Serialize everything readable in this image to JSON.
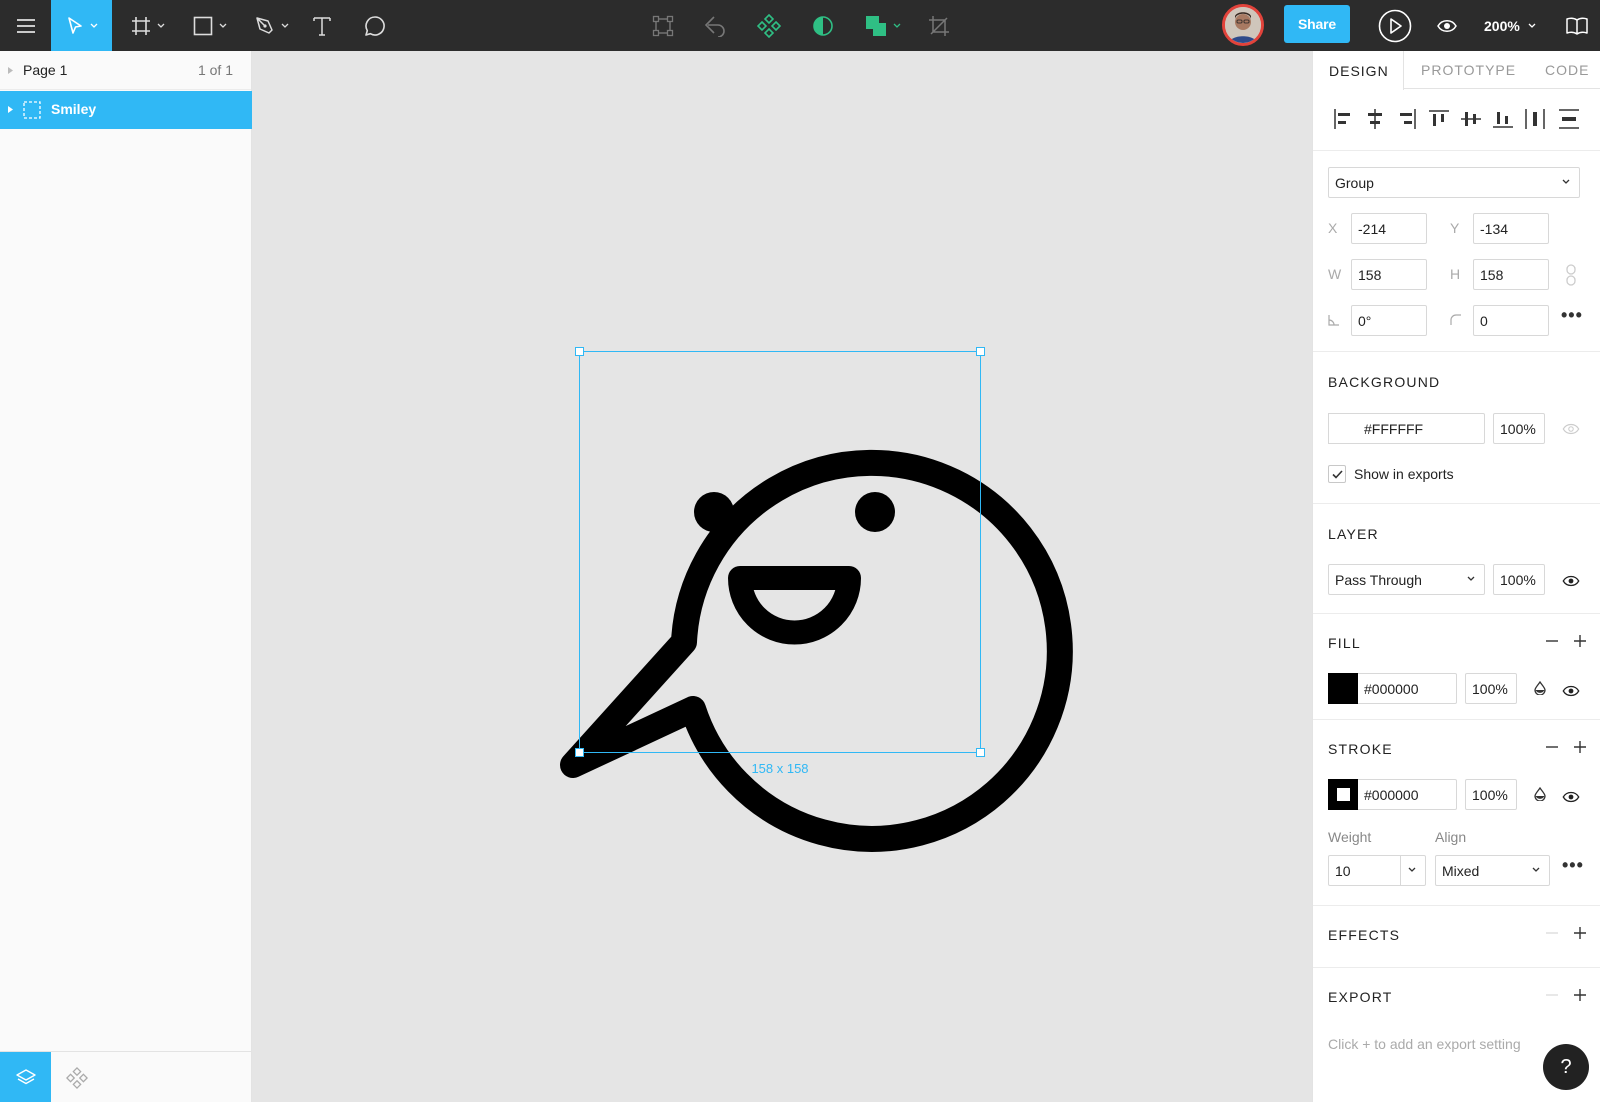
{
  "toolbar": {
    "share_label": "Share",
    "zoom_label": "200%",
    "tools": [
      "menu-icon",
      "move-icon",
      "frame-icon",
      "rectangle-icon",
      "pen-icon",
      "text-icon",
      "comment-icon"
    ],
    "center_tools": [
      "component-bounds-icon",
      "boolean-icon",
      "create-component-icon",
      "mask-icon",
      "union-icon",
      "crop-icon"
    ],
    "accent": "#30b8f5"
  },
  "left_panel": {
    "page_name": "Page 1",
    "page_count": "1 of 1",
    "layers": [
      {
        "name": "Smiley",
        "selected": true
      }
    ]
  },
  "canvas": {
    "selection_size": "158 x 158",
    "background": "#e5e5e5"
  },
  "right_panel": {
    "tabs": [
      "DESIGN",
      "PROTOTYPE",
      "CODE"
    ],
    "active_tab": "DESIGN",
    "group_select": "Group",
    "x_label": "X",
    "x_value": "-214",
    "y_label": "Y",
    "y_value": "-134",
    "w_label": "W",
    "w_value": "158",
    "h_label": "H",
    "h_value": "158",
    "rotation_value": "0°",
    "radius_value": "0",
    "background": {
      "title": "BACKGROUND",
      "color": "#FFFFFF",
      "opacity": "100%",
      "show_in_exports": "Show in exports",
      "show_in_exports_checked": true
    },
    "layer": {
      "title": "LAYER",
      "blend": "Pass Through",
      "opacity": "100%"
    },
    "fill": {
      "title": "FILL",
      "color": "#000000",
      "opacity": "100%"
    },
    "stroke": {
      "title": "STROKE",
      "color": "#000000",
      "opacity": "100%",
      "weight_label": "Weight",
      "weight_value": "10",
      "align_label": "Align",
      "align_value": "Mixed"
    },
    "effects": {
      "title": "EFFECTS"
    },
    "export": {
      "title": "EXPORT",
      "hint": "Click + to add an export setting"
    }
  },
  "help_label": "?"
}
